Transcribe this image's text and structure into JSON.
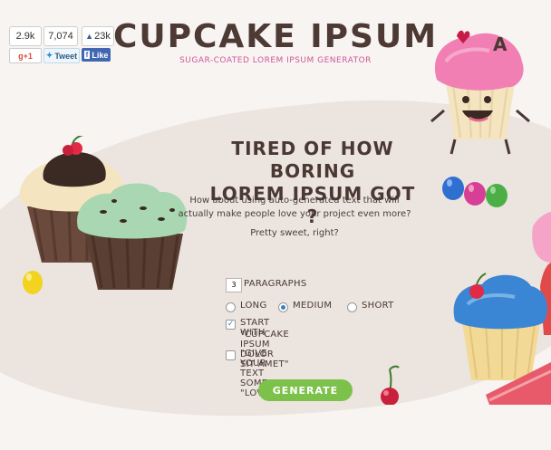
{
  "social": {
    "gplus_count": "2.9k",
    "gplus_label": "g+1",
    "twitter_count": "7,074",
    "twitter_label": "Tweet",
    "facebook_count": "23k",
    "facebook_label": "Like"
  },
  "header": {
    "title": "CUPCAKE IPSUM",
    "subtitle": "SUGAR-COATED LOREM IPSUM GENERATOR"
  },
  "intro": {
    "headline_line1": "TIRED OF HOW BORING",
    "headline_line2": "LOREM IPSUM GOT ?",
    "body": "How about using auto-generated text that will actually make people love your project even more?",
    "tagline": "Pretty sweet, right?"
  },
  "form": {
    "paragraph_count": "3",
    "paragraphs_label": "PARAGRAPHS",
    "length_options": [
      {
        "label": "LONG",
        "selected": false
      },
      {
        "label": "MEDIUM",
        "selected": true
      },
      {
        "label": "SHORT",
        "selected": false
      }
    ],
    "start_with_checked": true,
    "start_with_label_1": "START WITH",
    "start_with_label_2": "\"CUPCAKE IPSUM DOLOR SIT AMET\"",
    "love_checked": false,
    "love_label": "\"GIVE YOUR TEXT SOME \"LOVE\"",
    "generate_label": "GENERATE"
  },
  "mascot": {
    "letter": "A"
  },
  "colors": {
    "accent_pink": "#d2569c",
    "generate_green": "#7cc24a",
    "twitter_blue": "#2f8ccf",
    "facebook_blue": "#3b5998",
    "gplus_red": "#dd4b39"
  }
}
